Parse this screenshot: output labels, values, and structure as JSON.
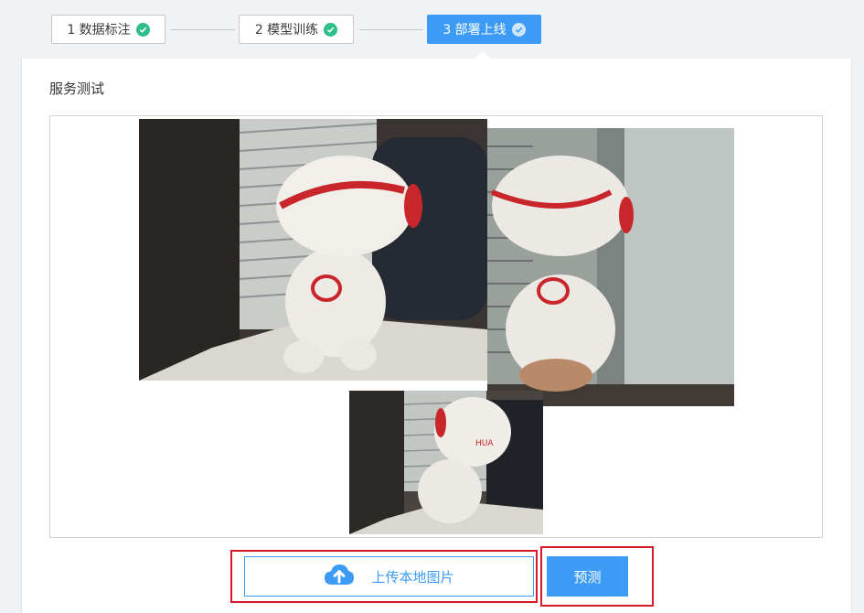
{
  "steps": [
    {
      "label": "1 数据标注",
      "status": "done"
    },
    {
      "label": "2 模型训练",
      "status": "done"
    },
    {
      "label": "3 部署上线",
      "status": "active"
    }
  ],
  "section": {
    "title": "服务测试"
  },
  "actions": {
    "upload_label": "上传本地图片",
    "predict_label": "预测"
  },
  "colors": {
    "primary": "#3b9bf5",
    "success": "#2dbe8a",
    "highlight": "#d9192b"
  },
  "icons": {
    "step_done": "check-circle-icon",
    "upload": "cloud-upload-icon"
  }
}
